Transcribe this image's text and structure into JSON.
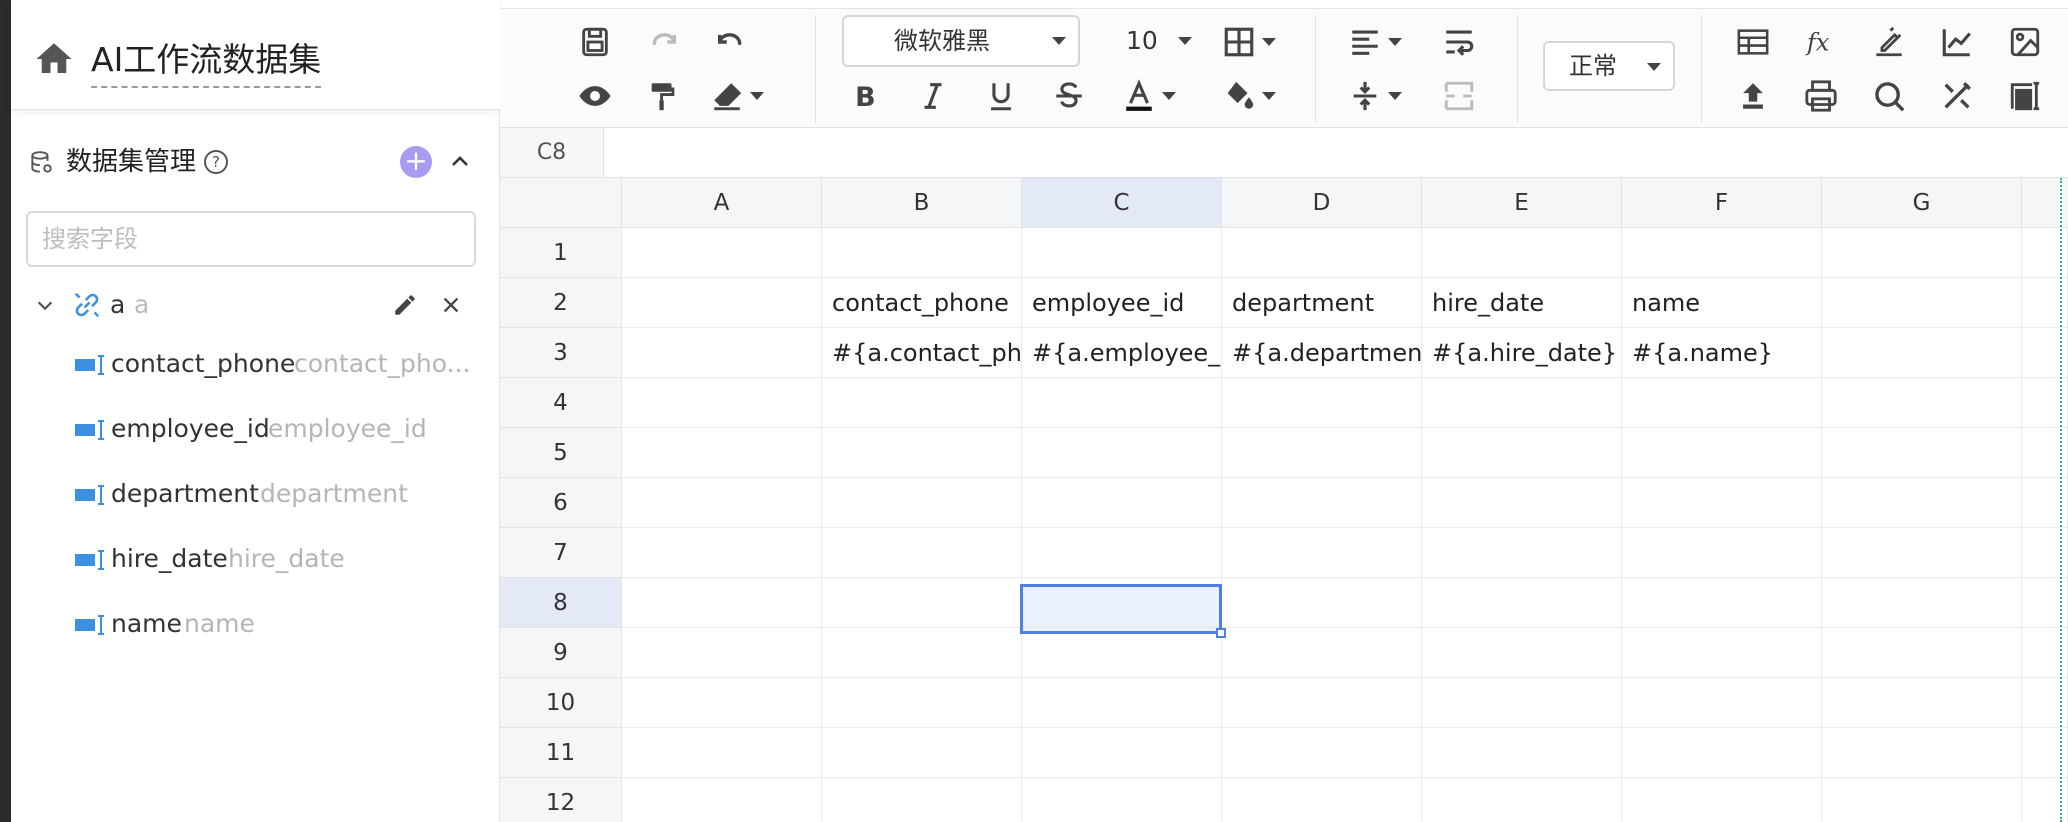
{
  "app": {
    "title": "AI工作流数据集"
  },
  "panel": {
    "title": "数据集管理",
    "help": "?",
    "add": "+"
  },
  "search": {
    "placeholder": "搜索字段",
    "value": ""
  },
  "dataset": {
    "name": "a",
    "alias": "a",
    "fields": [
      {
        "name": "contact_phone",
        "alias": "contact_pho..."
      },
      {
        "name": "employee_id",
        "alias": "employee_id"
      },
      {
        "name": "department",
        "alias": "department"
      },
      {
        "name": "hire_date",
        "alias": "hire_date"
      },
      {
        "name": "name",
        "alias": "name"
      }
    ]
  },
  "toolbar": {
    "font": "微软雅黑",
    "font_size": "10",
    "number_format": "正常",
    "icons": [
      "save-icon",
      "redo-icon",
      "undo-icon",
      "preview-icon",
      "format-painter-icon",
      "eraser-icon",
      "bold-icon",
      "italic-icon",
      "underline-icon",
      "strikethrough-icon",
      "font-color-icon",
      "fill-color-icon",
      "border-icon",
      "align-icon",
      "wrap-icon",
      "valign-icon",
      "merge-icon",
      "table-icon",
      "function-icon",
      "chart-icon",
      "image-icon",
      "upload-icon",
      "print-icon",
      "search-icon",
      "tools-icon",
      "freeze-icon"
    ]
  },
  "formula_bar": {
    "cell_ref": "C8",
    "value": ""
  },
  "sheet": {
    "columns": [
      "A",
      "B",
      "C",
      "D",
      "E",
      "F",
      "G"
    ],
    "rows": [
      "1",
      "2",
      "3",
      "4",
      "5",
      "6",
      "7",
      "8",
      "9",
      "10",
      "11",
      "12"
    ],
    "selected_cell": "C8",
    "row2": [
      "contact_phone",
      "employee_id",
      "department",
      "hire_date",
      "name"
    ],
    "row3": [
      "#{a.contact_ph",
      "#{a.employee_i",
      "#{a.departmen",
      "#{a.hire_date}",
      "#{a.name}"
    ]
  },
  "colors": {
    "accent": "#4f7fe0",
    "add_button": "#a99bf0",
    "field_icon": "#3d8fe0"
  }
}
